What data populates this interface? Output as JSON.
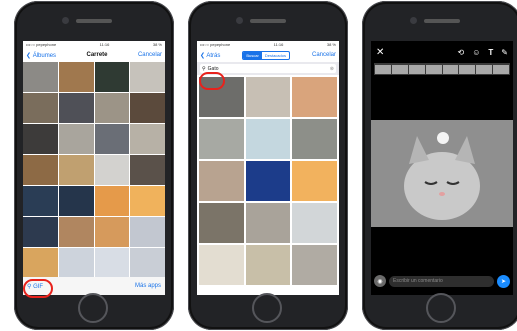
{
  "photos": {
    "status": {
      "carrier": "•••○○ pepephone",
      "time": "11:16",
      "battery": "38 %"
    },
    "nav": {
      "back": "❮ Álbumes",
      "title": "Carrete",
      "cancel": "Cancelar"
    },
    "search_label": "GIF",
    "more_apps": "Más apps"
  },
  "gif": {
    "status": {
      "carrier": "•••○○ pepephone",
      "time": "11:16",
      "battery": "38 %"
    },
    "nav": {
      "back": "❮ Atrás",
      "tab_search": "Buscar",
      "tab_featured": "Destacados",
      "cancel": "Cancelar"
    },
    "search_value": "Gato"
  },
  "editor": {
    "close": "✕",
    "icons": [
      "crop-rotate-icon",
      "emoji-icon",
      "text-icon",
      "pencil-icon"
    ],
    "comment_placeholder": "Escribir un comentario"
  },
  "colors": {
    "accent": "#1a73e8",
    "highlight": "#e8221c",
    "send": "#1a8cff"
  }
}
